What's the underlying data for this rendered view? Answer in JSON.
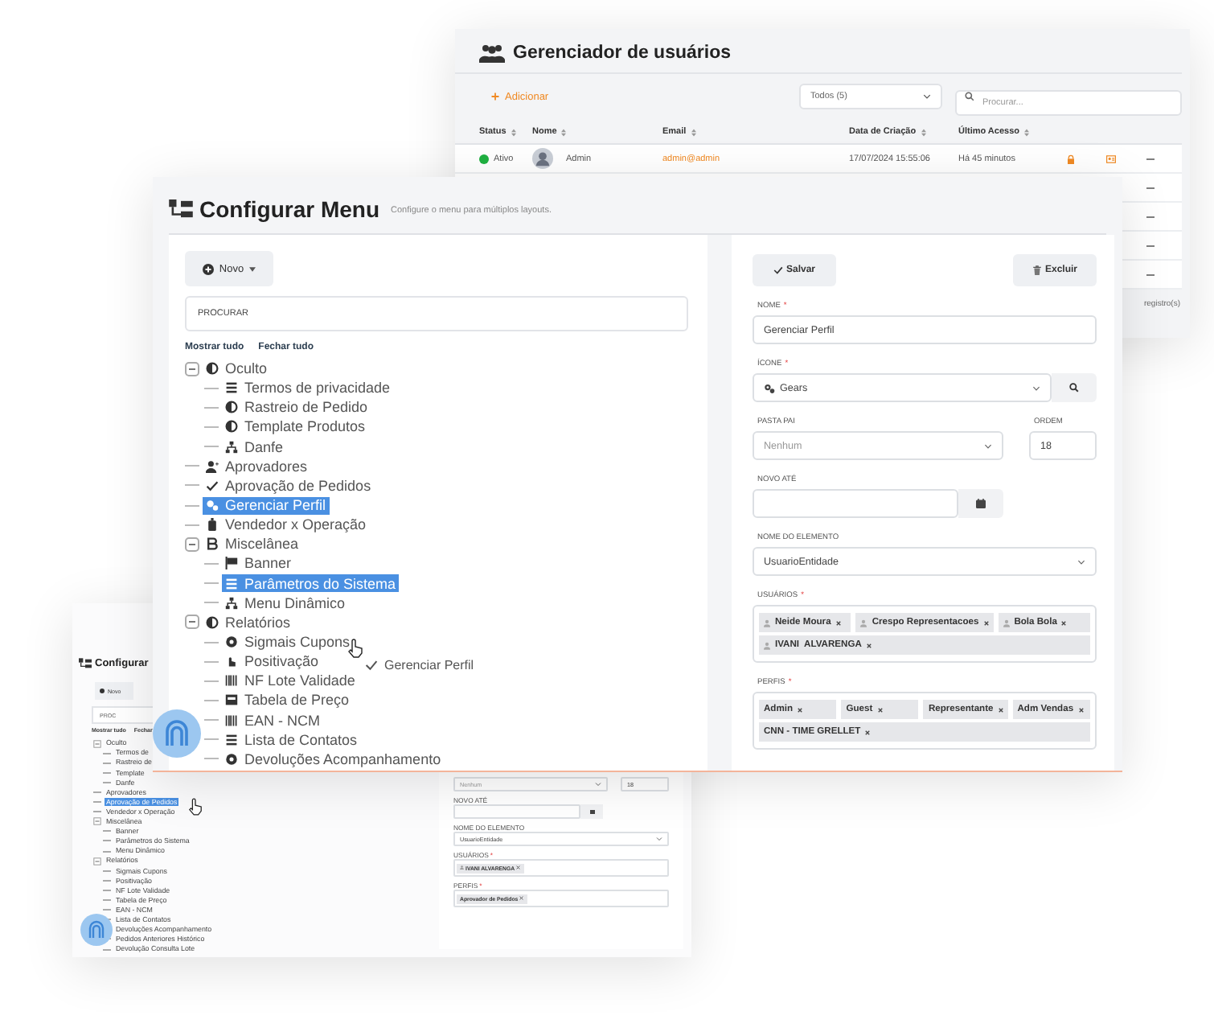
{
  "users_window": {
    "title": "Gerenciador de usuários",
    "add_button": "Adicionar",
    "filter": {
      "value": "Todos (5)"
    },
    "search": {
      "placeholder": "Procurar..."
    },
    "columns": [
      "Status",
      "Nome",
      "Email",
      "Data de Criação",
      "Último Acesso"
    ],
    "rows": [
      {
        "kind": "user",
        "status": "Ativo",
        "color": "#1fb141",
        "name": "Admin",
        "email": "admin@admin",
        "created": "17/07/2024 15:55:06",
        "last_access": "Há 45 minutos"
      },
      {
        "kind": "covered"
      },
      {
        "kind": "covered"
      },
      {
        "kind": "covered"
      },
      {
        "kind": "covered"
      }
    ],
    "footer": "registro(s)"
  },
  "menu_window": {
    "title": "Configurar Menu",
    "subtitle": "Configure o menu para múltiplos layouts.",
    "new_button": "Novo",
    "search": {
      "placeholder": "PROCURAR"
    },
    "links": [
      "Mostrar tudo",
      "Fechar tudo"
    ],
    "tree": [
      {
        "label": "Oculto",
        "selected": false,
        "expanded": true,
        "children": [
          {
            "label": "Termos de privacidade",
            "selected": false
          },
          {
            "label": "Rastreio de Pedido",
            "selected": false
          },
          {
            "label": "Template Produtos",
            "selected": false
          },
          {
            "label": "Danfe",
            "selected": false
          }
        ]
      },
      {
        "label": "Aprovadores",
        "selected": false
      },
      {
        "label": "Aprovação de Pedidos",
        "selected": false
      },
      {
        "label": "Gerenciar Perfil",
        "selected": true
      },
      {
        "label": "Vendedor x Operação",
        "selected": false
      },
      {
        "label": "Miscelânea",
        "selected": false,
        "expanded": true,
        "children": [
          {
            "label": "Banner",
            "selected": false
          },
          {
            "label": "Parâmetros do Sistema",
            "selected": true
          },
          {
            "label": "Menu Dinâmico",
            "selected": false
          }
        ]
      },
      {
        "label": "Relatórios",
        "selected": false,
        "expanded": true,
        "children": [
          {
            "label": "Sigmais Cupons",
            "selected": false
          },
          {
            "label": "Positivação",
            "selected": false
          },
          {
            "label": "NF Lote Validade",
            "selected": false
          },
          {
            "label": "Tabela de Preço",
            "selected": false
          },
          {
            "label": "EAN - NCM",
            "selected": false
          },
          {
            "label": "Lista de Contatos",
            "selected": false
          },
          {
            "label": "Devoluções Acompanhamento",
            "selected": false
          }
        ]
      }
    ],
    "drag_label": "Gerenciar Perfil",
    "form": {
      "save_button": "Salvar",
      "delete_button": "Excluir",
      "fields": [
        {
          "kind": "text",
          "label": "NOME",
          "mark": "*",
          "value": "Gerenciar Perfil"
        },
        {
          "kind": "icon_select",
          "label": "ÍCONE",
          "mark": "*",
          "value": "Gears"
        },
        {
          "kind": "select_number",
          "label": "PASTA PAI",
          "placeholder": "Nenhum",
          "label_2": "ORDEM",
          "value_2": "18"
        },
        {
          "kind": "date",
          "label": "NOVO ATÉ"
        },
        {
          "kind": "select",
          "label": "NOME DO ELEMENTO",
          "value": "UsuarioEntidade"
        },
        {
          "kind": "tags",
          "label": "USUÁRIOS",
          "mark": "*",
          "person": true,
          "tags": [
            "Neide Moura",
            "Crespo Representacoes",
            "Bola Bola",
            "IVANI  ALVARENGA"
          ]
        },
        {
          "kind": "tags",
          "label": "PERFIS",
          "mark": "*",
          "person": false,
          "tags": [
            "Admin",
            "Guest",
            "Representante",
            "Adm Vendas",
            "CNN - TIME GRELLET"
          ]
        }
      ]
    }
  },
  "preview_window": {
    "title": "Configurar",
    "new_button": "Novo",
    "search": {
      "placeholder": "PROC"
    },
    "links": [
      "Mostrar tudo",
      "Fechar"
    ],
    "tree": [
      {
        "label": "Oculto",
        "selected": false,
        "expanded": true,
        "children": [
          {
            "label": "Termos de",
            "selected": false
          },
          {
            "label": "Rastreio de",
            "selected": false
          },
          {
            "label": "Template",
            "selected": false
          },
          {
            "label": "Danfe",
            "selected": false
          }
        ]
      },
      {
        "label": "Aprovadores",
        "selected": false
      },
      {
        "label": "Aprovação de Pedidos",
        "selected": true
      },
      {
        "label": "Vendedor x Operação",
        "selected": false
      },
      {
        "label": "Miscelânea",
        "selected": false,
        "expanded": true,
        "children": [
          {
            "label": "Banner",
            "selected": false
          },
          {
            "label": "Parâmetros do Sistema",
            "selected": false
          },
          {
            "label": "Menu Dinâmico",
            "selected": false
          }
        ]
      },
      {
        "label": "Relatórios",
        "selected": false,
        "expanded": true,
        "children": [
          {
            "label": "Sigmais Cupons",
            "selected": false
          },
          {
            "label": "Positivação",
            "selected": false
          },
          {
            "label": "NF Lote Validade",
            "selected": false
          },
          {
            "label": "Tabela de Preço",
            "selected": false
          },
          {
            "label": "EAN - NCM",
            "selected": false
          },
          {
            "label": "Lista de Contatos",
            "selected": false
          },
          {
            "label": "Devoluções Acompanhamento",
            "selected": false
          },
          {
            "label": "Pedidos Anteriores Histórico",
            "selected": false
          },
          {
            "label": "Devolução Consulta Lote",
            "selected": false
          }
        ]
      }
    ],
    "form": {
      "fields": [
        {
          "kind": "select_number",
          "placeholder": "Nenhum",
          "value_2": "18"
        },
        {
          "kind": "date",
          "label": "NOVO ATÉ"
        },
        {
          "kind": "select",
          "label": "NOME DO ELEMENTO",
          "value": "UsuarioEntidade"
        },
        {
          "kind": "tags",
          "label": "USUÁRIOS",
          "mark": "*",
          "person": true,
          "tags": [
            "IVANI ALVARENGA"
          ]
        },
        {
          "kind": "tags",
          "label": "PERFIS",
          "mark": "*",
          "person": false,
          "tags": [
            "Aprovador de Pedidos"
          ]
        }
      ]
    }
  }
}
